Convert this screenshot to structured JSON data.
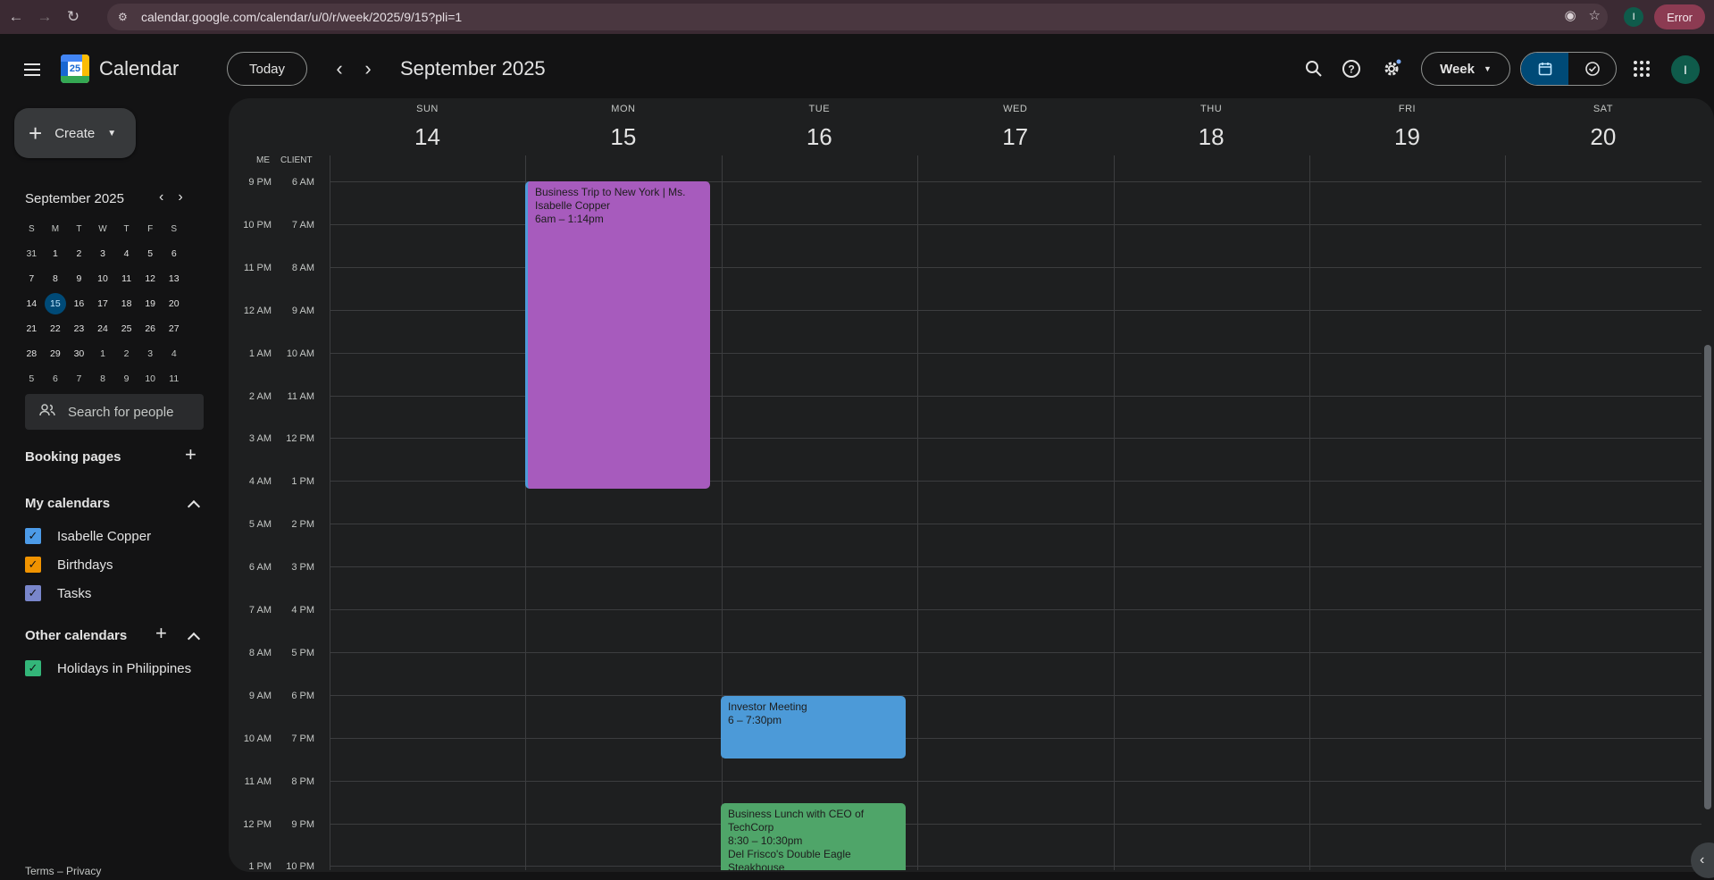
{
  "browser": {
    "url": "calendar.google.com/calendar/u/0/r/week/2025/9/15?pli=1",
    "profile_initial": "I",
    "error_label": "Error"
  },
  "header": {
    "app_title": "Calendar",
    "logo_number": "25",
    "today_label": "Today",
    "month_label": "September 2025",
    "view_label": "Week",
    "avatar_initial": "I"
  },
  "sidebar": {
    "create_label": "Create",
    "mini_calendar": {
      "title": "September 2025",
      "dow": [
        "S",
        "M",
        "T",
        "W",
        "T",
        "F",
        "S"
      ],
      "weeks": [
        [
          "31",
          "1",
          "2",
          "3",
          "4",
          "5",
          "6"
        ],
        [
          "7",
          "8",
          "9",
          "10",
          "11",
          "12",
          "13"
        ],
        [
          "14",
          "15",
          "16",
          "17",
          "18",
          "19",
          "20"
        ],
        [
          "21",
          "22",
          "23",
          "24",
          "25",
          "26",
          "27"
        ],
        [
          "28",
          "29",
          "30",
          "1",
          "2",
          "3",
          "4"
        ],
        [
          "5",
          "6",
          "7",
          "8",
          "9",
          "10",
          "11"
        ]
      ],
      "selected": "15"
    },
    "search_placeholder": "Search for people",
    "booking_pages": "Booking pages",
    "my_calendars": "My calendars",
    "my_calendar_items": [
      {
        "label": "Isabelle Copper",
        "color": "#4c9be8"
      },
      {
        "label": "Birthdays",
        "color": "#f09300"
      },
      {
        "label": "Tasks",
        "color": "#7986cb"
      }
    ],
    "other_calendars": "Other calendars",
    "other_calendar_items": [
      {
        "label": "Holidays in Philippines",
        "color": "#33b679"
      }
    ],
    "footer": "Terms – Privacy"
  },
  "week": {
    "days": [
      {
        "dow": "SUN",
        "num": "14"
      },
      {
        "dow": "MON",
        "num": "15"
      },
      {
        "dow": "TUE",
        "num": "16"
      },
      {
        "dow": "WED",
        "num": "17"
      },
      {
        "dow": "THU",
        "num": "18"
      },
      {
        "dow": "FRI",
        "num": "19"
      },
      {
        "dow": "SAT",
        "num": "20"
      }
    ],
    "tz_me": "ME",
    "tz_client": "CLIENT",
    "times_me": [
      "9 PM",
      "10 PM",
      "11 PM",
      "12 AM",
      "1 AM",
      "2 AM",
      "3 AM",
      "4 AM",
      "5 AM",
      "6 AM",
      "7 AM",
      "8 AM",
      "9 AM",
      "10 AM",
      "11 AM",
      "12 PM",
      "1 PM"
    ],
    "times_client": [
      "6 AM",
      "7 AM",
      "8 AM",
      "9 AM",
      "10 AM",
      "11 AM",
      "12 PM",
      "1 PM",
      "2 PM",
      "3 PM",
      "4 PM",
      "5 PM",
      "6 PM",
      "7 PM",
      "8 PM",
      "9 PM",
      "10 PM"
    ]
  },
  "events": [
    {
      "title": "Business Trip to New York | Ms. Isabelle Copper",
      "time": "6am – 1:14pm",
      "location": "",
      "color": "#a75bbd"
    },
    {
      "title": "Investor Meeting",
      "time": "6 – 7:30pm",
      "location": "",
      "color": "#4c9ad8"
    },
    {
      "title": "Business Lunch with CEO of TechCorp",
      "time": "8:30 – 10:30pm",
      "location": "Del Frisco's Double Eagle Steakhouse",
      "color": "#4fa569"
    }
  ]
}
